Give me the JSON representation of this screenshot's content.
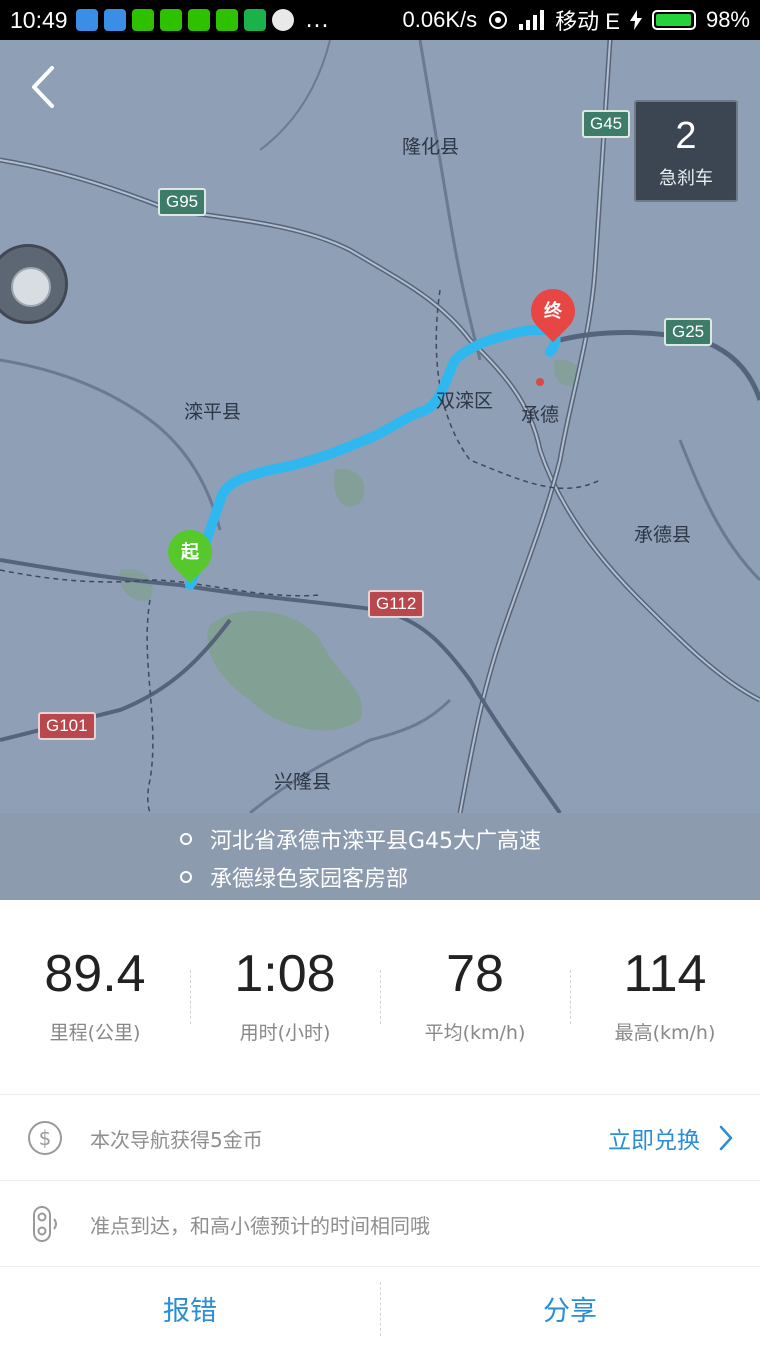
{
  "status_bar": {
    "time": "10:49",
    "more_indicator": "...",
    "network_speed": "0.06K/s",
    "carrier": "移动 E",
    "battery_text": "98%",
    "battery_level": 0.98,
    "notification_icons": [
      "mail-icon",
      "send-icon",
      "wechat-icon",
      "wechat-icon",
      "wechat-icon",
      "wechat-icon",
      "phone-icon",
      "app-icon"
    ]
  },
  "map": {
    "labels": {
      "longhua": "隆化县",
      "luanping": "滦平县",
      "shuangluan": "双滦区",
      "chengde": "承德",
      "chengde_county": "承德县",
      "xinglong": "兴隆县"
    },
    "shields": {
      "g45": "G45",
      "g95": "G95",
      "g25": "G25",
      "g112": "G112",
      "g101": "G101"
    },
    "start_pin": "起",
    "end_pin": "终"
  },
  "hard_braking": {
    "count": "2",
    "label": "急刹车"
  },
  "addresses": {
    "start": "河北省承德市滦平县G45大广高速",
    "end": "承德绿色家园客房部"
  },
  "stats": [
    {
      "value": "89.4",
      "label": "里程(公里)"
    },
    {
      "value": "1:08",
      "label": "用时(小时)"
    },
    {
      "value": "78",
      "label": "平均(km/h)"
    },
    {
      "value": "114",
      "label": "最高(km/h)"
    }
  ],
  "coins": {
    "text": "本次导航获得5金币",
    "action": "立即兑换"
  },
  "arrival": {
    "text": "准点到达，和高小德预计的时间相同哦"
  },
  "actions": {
    "report": "报错",
    "share": "分享"
  },
  "colors": {
    "accent": "#2a8dd8",
    "route": "#2fb8f0",
    "start_pin": "#57c82b",
    "end_pin": "#e84545"
  }
}
